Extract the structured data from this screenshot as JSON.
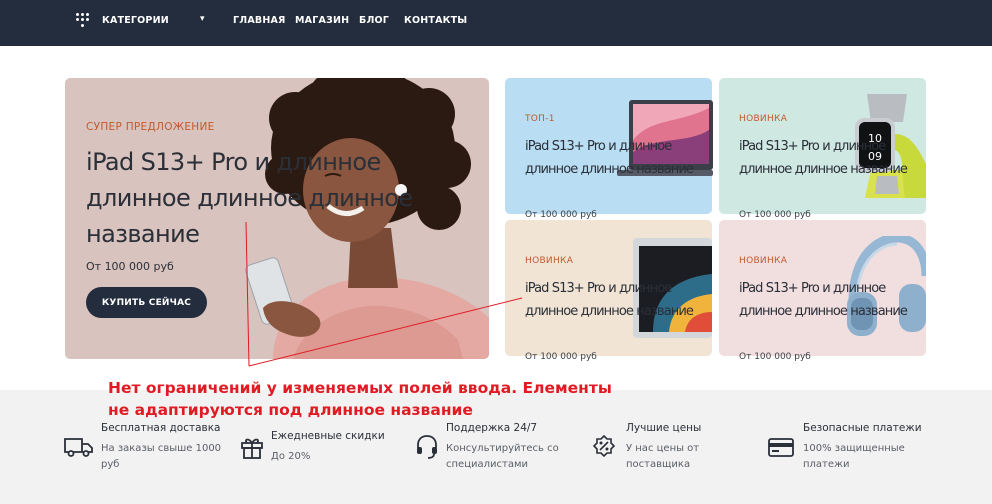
{
  "nav": {
    "categories_label": "КАТЕГОРИИ",
    "links": [
      "ГЛАВНАЯ",
      "МАГАЗИН",
      "БЛОГ",
      "КОНТАКТЫ"
    ]
  },
  "hero": {
    "kicker": "СУПЕР ПРЕДЛОЖЕНИЕ",
    "title": "iPad S13+ Pro и длинное длинное длинное длинное название",
    "price": "От 100 000 руб",
    "button": "КУПИТЬ СЕЙЧАС"
  },
  "cards": [
    {
      "label": "ТОП-1",
      "title": "iPad S13+ Pro и длинное длинное длинное название",
      "price": "От 100 000 руб",
      "bg": "#b9ddf2",
      "product": "laptop"
    },
    {
      "label": "НОВИНКА",
      "title": "iPad S13+ Pro и длинное длинное длинное название",
      "price": "От 100 000 руб",
      "bg": "#cfe8e2",
      "product": "smartwatch"
    },
    {
      "label": "НОВИНКА",
      "title": "iPad S13+ Pro и длинное длинное длинное название",
      "price": "От 100 000 руб",
      "bg": "#f1e4d4",
      "product": "tablet"
    },
    {
      "label": "НОВИНКА",
      "title": "iPad S13+ Pro и длинное длинное длинное название",
      "price": "От 100 000 руб",
      "bg": "#f1dede",
      "product": "headphones"
    }
  ],
  "annotation": {
    "line1": "Нет ограничений у изменяемых полей ввода. Елементы",
    "line2": "не адаптируются под длинное название",
    "color": "#e01b24"
  },
  "features": [
    {
      "icon": "truck-icon",
      "title": "Бесплатная доставка",
      "desc": "На заказы свыше 1000 руб"
    },
    {
      "icon": "gift-icon",
      "title": "Ежедневные скидки",
      "desc": "До 20%"
    },
    {
      "icon": "headset-icon",
      "title": "Поддержка 24/7",
      "desc": "Консультируйтесь со специалистами"
    },
    {
      "icon": "percent-badge-icon",
      "title": "Лучшие цены",
      "desc": "У нас цены от поставщика"
    },
    {
      "icon": "credit-card-icon",
      "title": "Безопасные платежи",
      "desc": "100% защищенные платежи"
    }
  ],
  "colors": {
    "nav_bg": "#232d3d",
    "accent": "#c25a2e",
    "hero_bg": "#d9c3be"
  }
}
